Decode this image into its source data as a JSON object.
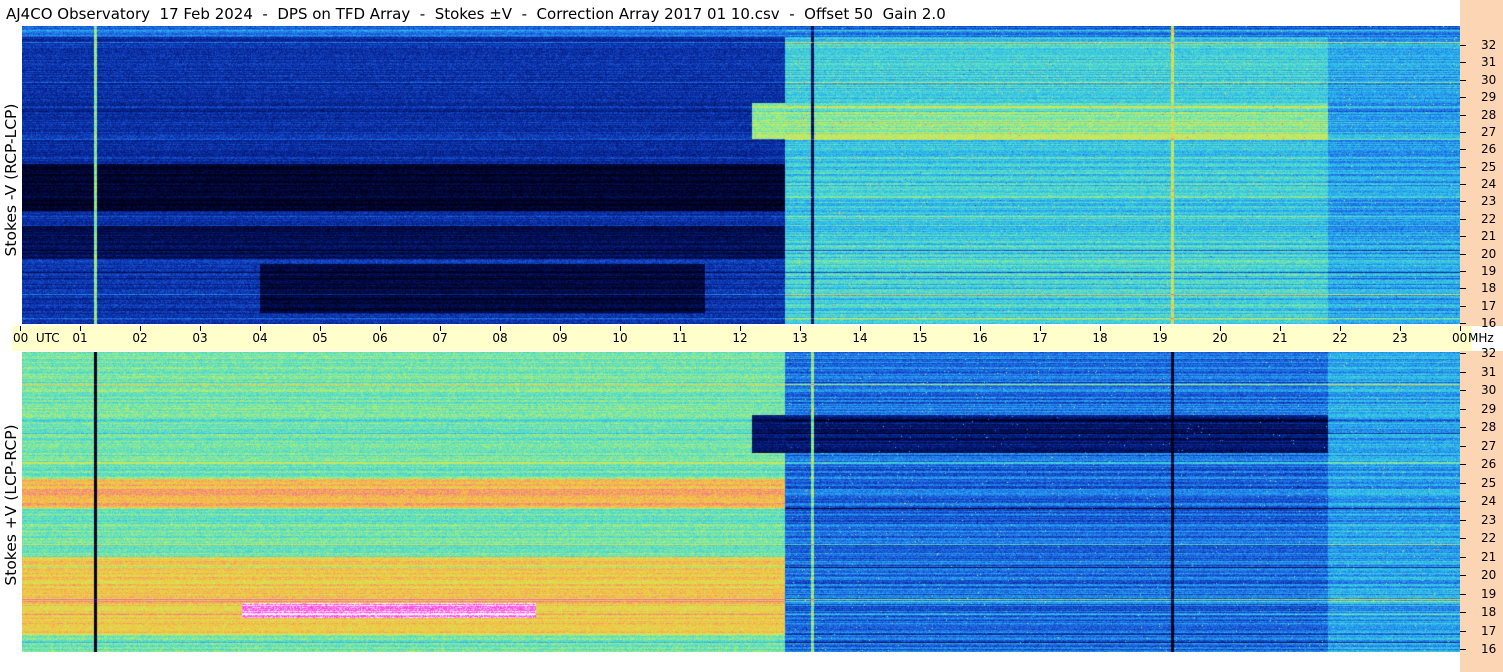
{
  "header": {
    "title": "AJ4CO Observatory  17 Feb 2024  -  DPS on TFD Array  -  Stokes ±V  -  Correction Array 2017 01 10.csv  -  Offset 50  Gain 2.0"
  },
  "colors": {
    "background": "#ffffff",
    "time_axis_band": "#ffffcc",
    "frequency_axis_band": "#fcd6b4",
    "colormap": [
      "#000018",
      "#00105a",
      "#0a2ea8",
      "#1f6ae6",
      "#2ab6ee",
      "#58e0c8",
      "#c8f05a",
      "#f8c040",
      "#f0709a",
      "#ff40e0",
      "#ffffff"
    ]
  },
  "chart_data": [
    {
      "type": "heatmap",
      "panel": "top",
      "ylabel": "Stokes -V (RCP-LCP)",
      "x_unit": "UTC",
      "y_unit": "MHz",
      "xlim": [
        0,
        24
      ],
      "ylim": [
        15.5,
        32.5
      ],
      "x_tick_labels": [
        "00",
        "01",
        "02",
        "03",
        "04",
        "05",
        "06",
        "07",
        "08",
        "09",
        "10",
        "11",
        "12",
        "13",
        "14",
        "15",
        "16",
        "17",
        "18",
        "19",
        "20",
        "21",
        "22",
        "23",
        "00"
      ],
      "y_ticks": [
        16,
        17,
        18,
        19,
        20,
        21,
        22,
        23,
        24,
        25,
        26,
        27,
        28,
        29,
        30,
        31,
        32
      ],
      "color_scale": "approx. 0 (dark) to 1 (bright)",
      "regions": [
        {
          "utc": [
            0.0,
            12.75
          ],
          "MHz": [
            16.0,
            32.5
          ],
          "level": 0.2
        },
        {
          "utc": [
            0.0,
            12.75
          ],
          "MHz": [
            22.5,
            25.2
          ],
          "level": 0.03
        },
        {
          "utc": [
            0.0,
            12.75
          ],
          "MHz": [
            19.7,
            21.6
          ],
          "level": 0.09
        },
        {
          "utc": [
            4.0,
            11.4
          ],
          "MHz": [
            16.6,
            19.4
          ],
          "level": 0.05
        },
        {
          "utc": [
            12.75,
            24.0
          ],
          "MHz": [
            15.5,
            32.5
          ],
          "level": 0.45
        },
        {
          "utc": [
            12.2,
            21.8
          ],
          "MHz": [
            26.6,
            28.7
          ],
          "level": 0.56
        },
        {
          "utc": [
            21.8,
            24.0
          ],
          "MHz": [
            15.5,
            32.5
          ],
          "level": 0.38
        }
      ],
      "lines": [
        {
          "utc": 1.25,
          "level": 0.55
        },
        {
          "utc": 13.2,
          "level": 0.1
        },
        {
          "utc": 19.2,
          "level": 0.62
        }
      ]
    },
    {
      "type": "heatmap",
      "panel": "bottom",
      "ylabel": "Stokes +V (LCP-RCP)",
      "x_unit": "UTC",
      "y_unit": "MHz",
      "xlim": [
        0,
        24
      ],
      "ylim": [
        15.5,
        32.5
      ],
      "x_tick_labels": [
        "00",
        "01",
        "02",
        "03",
        "04",
        "05",
        "06",
        "07",
        "08",
        "09",
        "10",
        "11",
        "12",
        "13",
        "14",
        "15",
        "16",
        "17",
        "18",
        "19",
        "20",
        "21",
        "22",
        "23",
        "00"
      ],
      "y_ticks": [
        16,
        17,
        18,
        19,
        20,
        21,
        22,
        23,
        24,
        25,
        26,
        27,
        28,
        29,
        30,
        31,
        32
      ],
      "color_scale": "approx. 0 (dark) to 1 (bright)",
      "regions": [
        {
          "utc": [
            0.0,
            12.75
          ],
          "MHz": [
            15.5,
            32.5
          ],
          "level": 0.52
        },
        {
          "utc": [
            0.0,
            12.75
          ],
          "MHz": [
            23.6,
            25.2
          ],
          "level": 0.72
        },
        {
          "utc": [
            0.0,
            12.75
          ],
          "MHz": [
            16.8,
            21.0
          ],
          "level": 0.68
        },
        {
          "utc": [
            3.7,
            8.6
          ],
          "MHz": [
            17.7,
            18.5
          ],
          "level": 0.95
        },
        {
          "utc": [
            12.75,
            24.0
          ],
          "MHz": [
            15.5,
            32.5
          ],
          "level": 0.3
        },
        {
          "utc": [
            12.2,
            21.8
          ],
          "MHz": [
            26.6,
            28.7
          ],
          "level": 0.12
        },
        {
          "utc": [
            21.8,
            24.0
          ],
          "MHz": [
            15.5,
            32.5
          ],
          "level": 0.38
        }
      ],
      "lines": [
        {
          "utc": 1.25,
          "level": 0.0
        },
        {
          "utc": 13.2,
          "level": 0.55
        },
        {
          "utc": 19.2,
          "level": 0.0
        }
      ]
    }
  ],
  "time_axis": {
    "labels": [
      "00  UTC",
      "01",
      "02",
      "03",
      "04",
      "05",
      "06",
      "07",
      "08",
      "09",
      "10",
      "11",
      "12",
      "13",
      "14",
      "15",
      "16",
      "17",
      "18",
      "19",
      "20",
      "21",
      "22",
      "23",
      "00"
    ],
    "unit": "MHz"
  }
}
